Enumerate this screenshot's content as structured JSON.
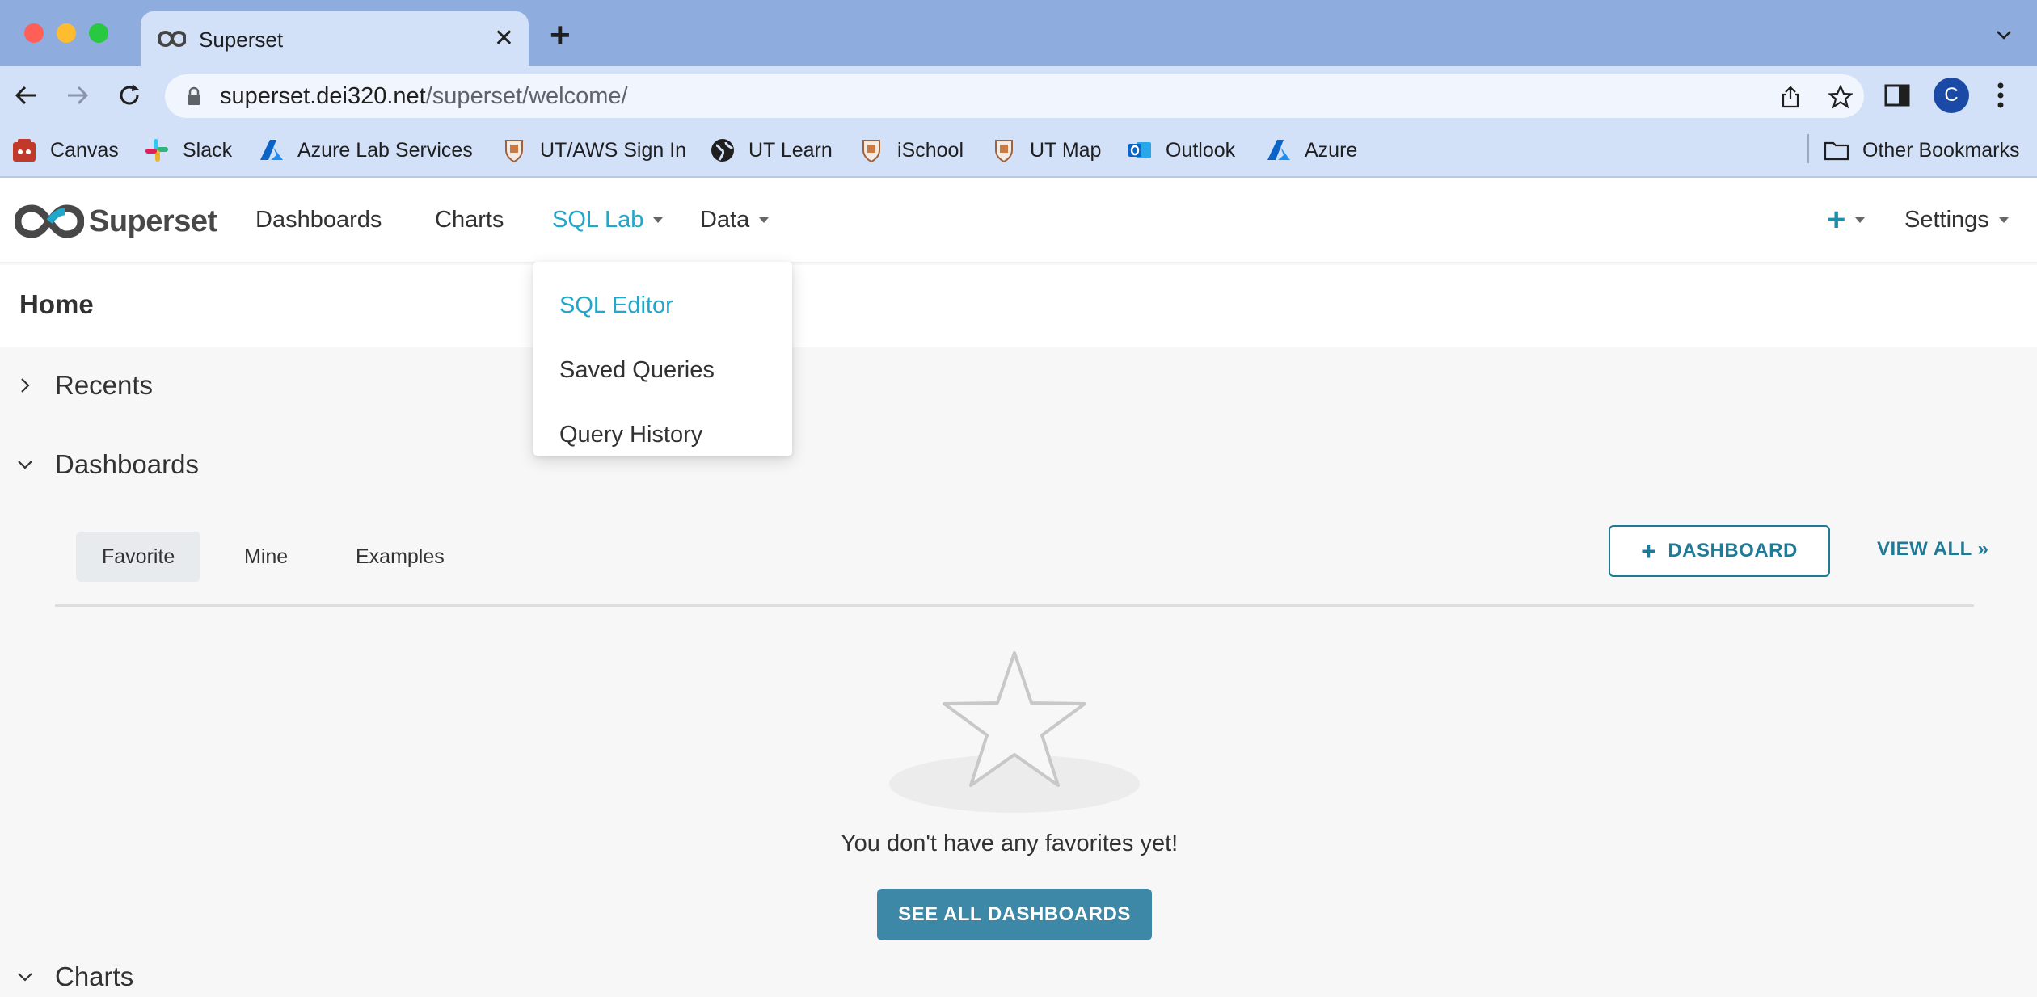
{
  "browser": {
    "tab_title": "Superset",
    "url_domain": "superset.dei320.net",
    "url_path": "/superset/welcome/",
    "profile_initial": "C",
    "bookmarks": [
      {
        "label": "Canvas",
        "icon": "canvas-icon"
      },
      {
        "label": "Slack",
        "icon": "slack-icon"
      },
      {
        "label": "Azure Lab Services",
        "icon": "azure-icon"
      },
      {
        "label": "UT/AWS Sign In",
        "icon": "shield-icon"
      },
      {
        "label": "UT Learn",
        "icon": "globe-icon"
      },
      {
        "label": "iSchool",
        "icon": "shield-icon"
      },
      {
        "label": "UT Map",
        "icon": "shield-icon"
      },
      {
        "label": "Outlook",
        "icon": "outlook-icon"
      },
      {
        "label": "Azure",
        "icon": "azure-icon"
      }
    ],
    "other_bookmarks": "Other Bookmarks"
  },
  "app": {
    "brand": "Superset",
    "nav": {
      "dashboards": "Dashboards",
      "charts": "Charts",
      "sql_lab": "SQL Lab",
      "data": "Data",
      "settings": "Settings"
    },
    "sql_lab_menu": [
      "SQL Editor",
      "Saved Queries",
      "Query History"
    ],
    "page_title": "Home",
    "sections": {
      "recents": "Recents",
      "dashboards": "Dashboards",
      "charts": "Charts"
    },
    "dashboard_tabs": [
      "Favorite",
      "Mine",
      "Examples"
    ],
    "add_dashboard": "DASHBOARD",
    "view_all": "VIEW ALL »",
    "empty_message": "You don't have any favorites yet!",
    "see_all": "SEE ALL DASHBOARDS"
  },
  "colors": {
    "accent": "#20a7c9",
    "primary_button": "#3d88a6",
    "outline_button": "#1f7a95"
  }
}
